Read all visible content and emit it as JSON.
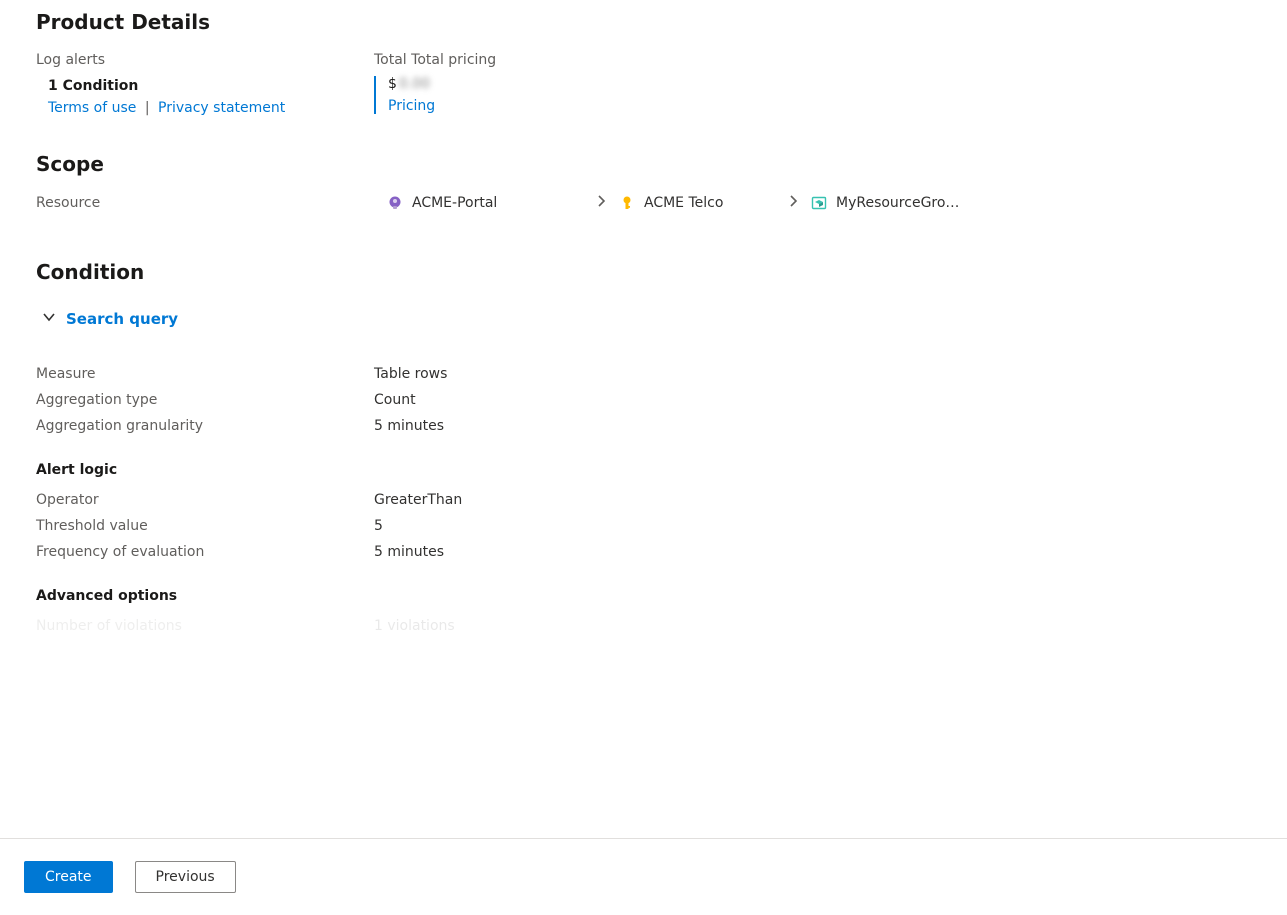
{
  "product": {
    "title": "Product Details",
    "left_label": "Log alerts",
    "condition": "1 Condition",
    "terms_link": "Terms of use",
    "privacy_link": "Privacy statement",
    "right_label": "Total Total pricing",
    "price_symbol": "$",
    "price_blur": "0.00",
    "pricing_link": "Pricing"
  },
  "scope": {
    "title": "Scope",
    "label": "Resource",
    "crumbs": [
      {
        "name": "ACME-Portal"
      },
      {
        "name": "ACME Telco"
      },
      {
        "name": "MyResourceGro…"
      }
    ]
  },
  "condition": {
    "title": "Condition",
    "toggle": "Search query",
    "measure": {
      "label": "Measure",
      "value": "Table rows"
    },
    "agg_type": {
      "label": "Aggregation type",
      "value": "Count"
    },
    "agg_gran": {
      "label": "Aggregation granularity",
      "value": "5 minutes"
    },
    "alert_logic_title": "Alert logic",
    "operator": {
      "label": "Operator",
      "value": "GreaterThan"
    },
    "threshold": {
      "label": "Threshold value",
      "value": "5"
    },
    "frequency": {
      "label": "Frequency of evaluation",
      "value": "5 minutes"
    },
    "advanced_title": "Advanced options",
    "violations": {
      "label": "Number of violations",
      "value": "1 violations"
    }
  },
  "footer": {
    "create": "Create",
    "previous": "Previous"
  }
}
